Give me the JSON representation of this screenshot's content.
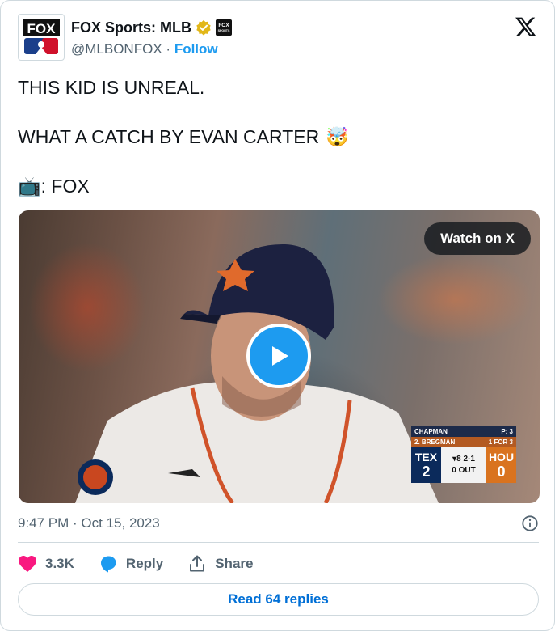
{
  "account": {
    "name": "FOX Sports: MLB",
    "handle": "@MLBONFOX",
    "separator": "·",
    "follow_label": "Follow",
    "avatar_text": "FOX",
    "affiliate_badge_text": "FOX SPORTS"
  },
  "tweet": {
    "lines": [
      "THIS KID IS UNREAL.",
      "WHAT A CATCH BY EVAN CARTER",
      ": FOX"
    ],
    "emoji_line2": "🤯",
    "emoji_line3": "📺"
  },
  "media": {
    "watch_label": "Watch on X",
    "scorebug": {
      "pitcher": "CHAPMAN",
      "pitch_count": "P: 3",
      "batter": "2. BREGMAN",
      "batter_stats": "1 FOR 3",
      "away_team": "TEX",
      "away_score": "2",
      "inning": "▾8",
      "count": "2-1",
      "outs": "0 OUT",
      "home_team": "HOU",
      "home_score": "0"
    }
  },
  "meta": {
    "timestamp": "9:47 PM · Oct 15, 2023"
  },
  "actions": {
    "like_count": "3.3K",
    "reply_label": "Reply",
    "share_label": "Share"
  },
  "read_replies_label": "Read 64 replies",
  "colors": {
    "accent": "#1d9bf0",
    "like": "#f91880",
    "verified_gold": "#e2b719",
    "text_secondary": "#536471"
  },
  "icons": [
    "x-logo-icon",
    "verified-badge-icon",
    "fox-sports-badge-icon",
    "play-icon",
    "heart-icon",
    "reply-bubble-icon",
    "share-icon",
    "info-icon"
  ]
}
